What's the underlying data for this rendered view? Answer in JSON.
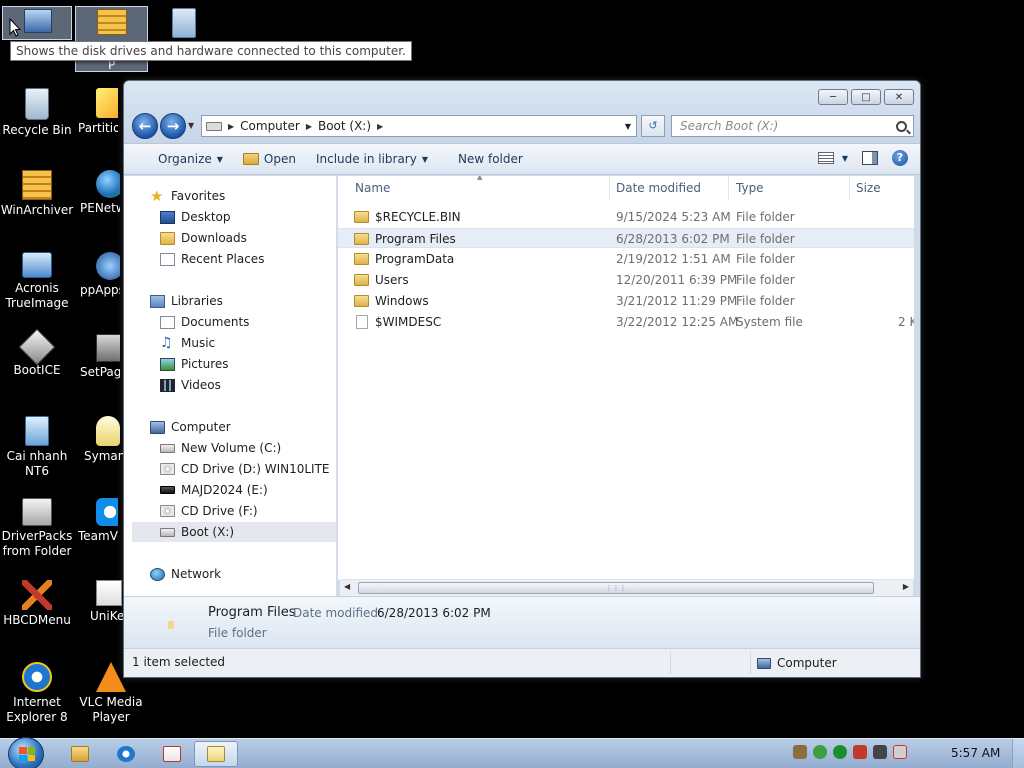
{
  "tooltip": "Shows the disk drives and hardware connected to this computer.",
  "top_icon_partial_label": "P",
  "desktop_icons": [
    {
      "label": "Recycle Bin"
    },
    {
      "label": "Partition"
    },
    {
      "label": "WinArchiver"
    },
    {
      "label": "PENetw"
    },
    {
      "label": "Acronis TrueImage"
    },
    {
      "label": "ppAppsr"
    },
    {
      "label": "BootICE"
    },
    {
      "label": "SetPage"
    },
    {
      "label": "Cai nhanh NT6"
    },
    {
      "label": "Syman Ghos"
    },
    {
      "label": "DriverPacks from Folder"
    },
    {
      "label": "TeamVie"
    },
    {
      "label": "HBCDMenu"
    },
    {
      "label": "UniKe"
    },
    {
      "label": "Internet Explorer 8"
    },
    {
      "label": "VLC Media Player"
    }
  ],
  "window": {
    "address": {
      "segments": [
        "Computer",
        "Boot (X:)"
      ]
    },
    "search_placeholder": "Search Boot (X:)",
    "toolbar": {
      "organize": "Organize",
      "open": "Open",
      "include": "Include in library",
      "new_folder": "New folder"
    },
    "nav": {
      "favorites": "Favorites",
      "desktop": "Desktop",
      "downloads": "Downloads",
      "recent": "Recent Places",
      "libraries": "Libraries",
      "documents": "Documents",
      "music": "Music",
      "pictures": "Pictures",
      "videos": "Videos",
      "computer": "Computer",
      "drive_c": "New Volume (C:)",
      "drive_d": "CD Drive (D:) WIN10LITE",
      "drive_e": "MAJD2024 (E:)",
      "drive_f": "CD Drive (F:)",
      "drive_x": "Boot (X:)",
      "network": "Network"
    },
    "columns": {
      "name": "Name",
      "modified": "Date modified",
      "type": "Type",
      "size": "Size"
    },
    "files": [
      {
        "name": "$RECYCLE.BIN",
        "modified": "9/15/2024 5:23 AM",
        "type": "File folder",
        "size": ""
      },
      {
        "name": "Program Files",
        "modified": "6/28/2013 6:02 PM",
        "type": "File folder",
        "size": ""
      },
      {
        "name": "ProgramData",
        "modified": "2/19/2012 1:51 AM",
        "type": "File folder",
        "size": ""
      },
      {
        "name": "Users",
        "modified": "12/20/2011 6:39 PM",
        "type": "File folder",
        "size": ""
      },
      {
        "name": "Windows",
        "modified": "3/21/2012 11:29 PM",
        "type": "File folder",
        "size": ""
      },
      {
        "name": "$WIMDESC",
        "modified": "3/22/2012 12:25 AM",
        "type": "System file",
        "size": "2 K"
      }
    ],
    "details": {
      "name": "Program Files",
      "modified_label": "Date modified:",
      "modified_value": "6/28/2013 6:02 PM",
      "type": "File folder"
    },
    "status": {
      "selected": "1 item selected",
      "location": "Computer"
    }
  },
  "taskbar": {
    "clock": "5:57 AM"
  }
}
